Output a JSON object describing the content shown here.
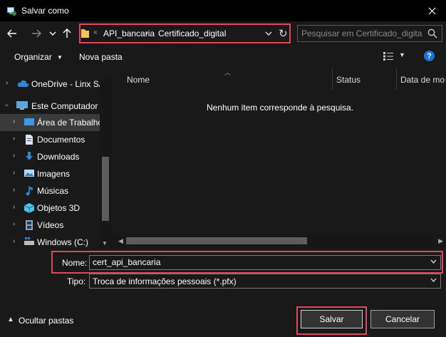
{
  "window": {
    "title": "Salvar como"
  },
  "address_bar": {
    "overflow": "«",
    "crumbs": [
      "API_bancaria",
      "Certificado_digital"
    ]
  },
  "search": {
    "placeholder": "Pesquisar em Certificado_digital"
  },
  "toolbar": {
    "organize": "Organizar",
    "new_folder": "Nova pasta",
    "help": "?"
  },
  "nav_tree": {
    "items": [
      {
        "label": "OneDrive - Linx SA"
      },
      {
        "label": "Este Computador"
      },
      {
        "label": "Área de Trabalho"
      },
      {
        "label": "Documentos"
      },
      {
        "label": "Downloads"
      },
      {
        "label": "Imagens"
      },
      {
        "label": "Músicas"
      },
      {
        "label": "Objetos 3D"
      },
      {
        "label": "Vídeos"
      },
      {
        "label": "Windows (C:)"
      }
    ]
  },
  "file_list": {
    "columns": [
      "Nome",
      "Status",
      "Data de mo"
    ],
    "empty_message": "Nenhum item corresponde à pesquisa."
  },
  "form": {
    "name_label": "Nome:",
    "name_value": "cert_api_bancaria",
    "type_label": "Tipo:",
    "type_value": "Troca de informações pessoais (*.pfx)"
  },
  "footer": {
    "hide_folders": "Ocultar pastas",
    "save": "Salvar",
    "cancel": "Cancelar"
  },
  "colors": {
    "highlight": "#e0475c",
    "background": "#191919",
    "accent": "#1a73d9"
  }
}
